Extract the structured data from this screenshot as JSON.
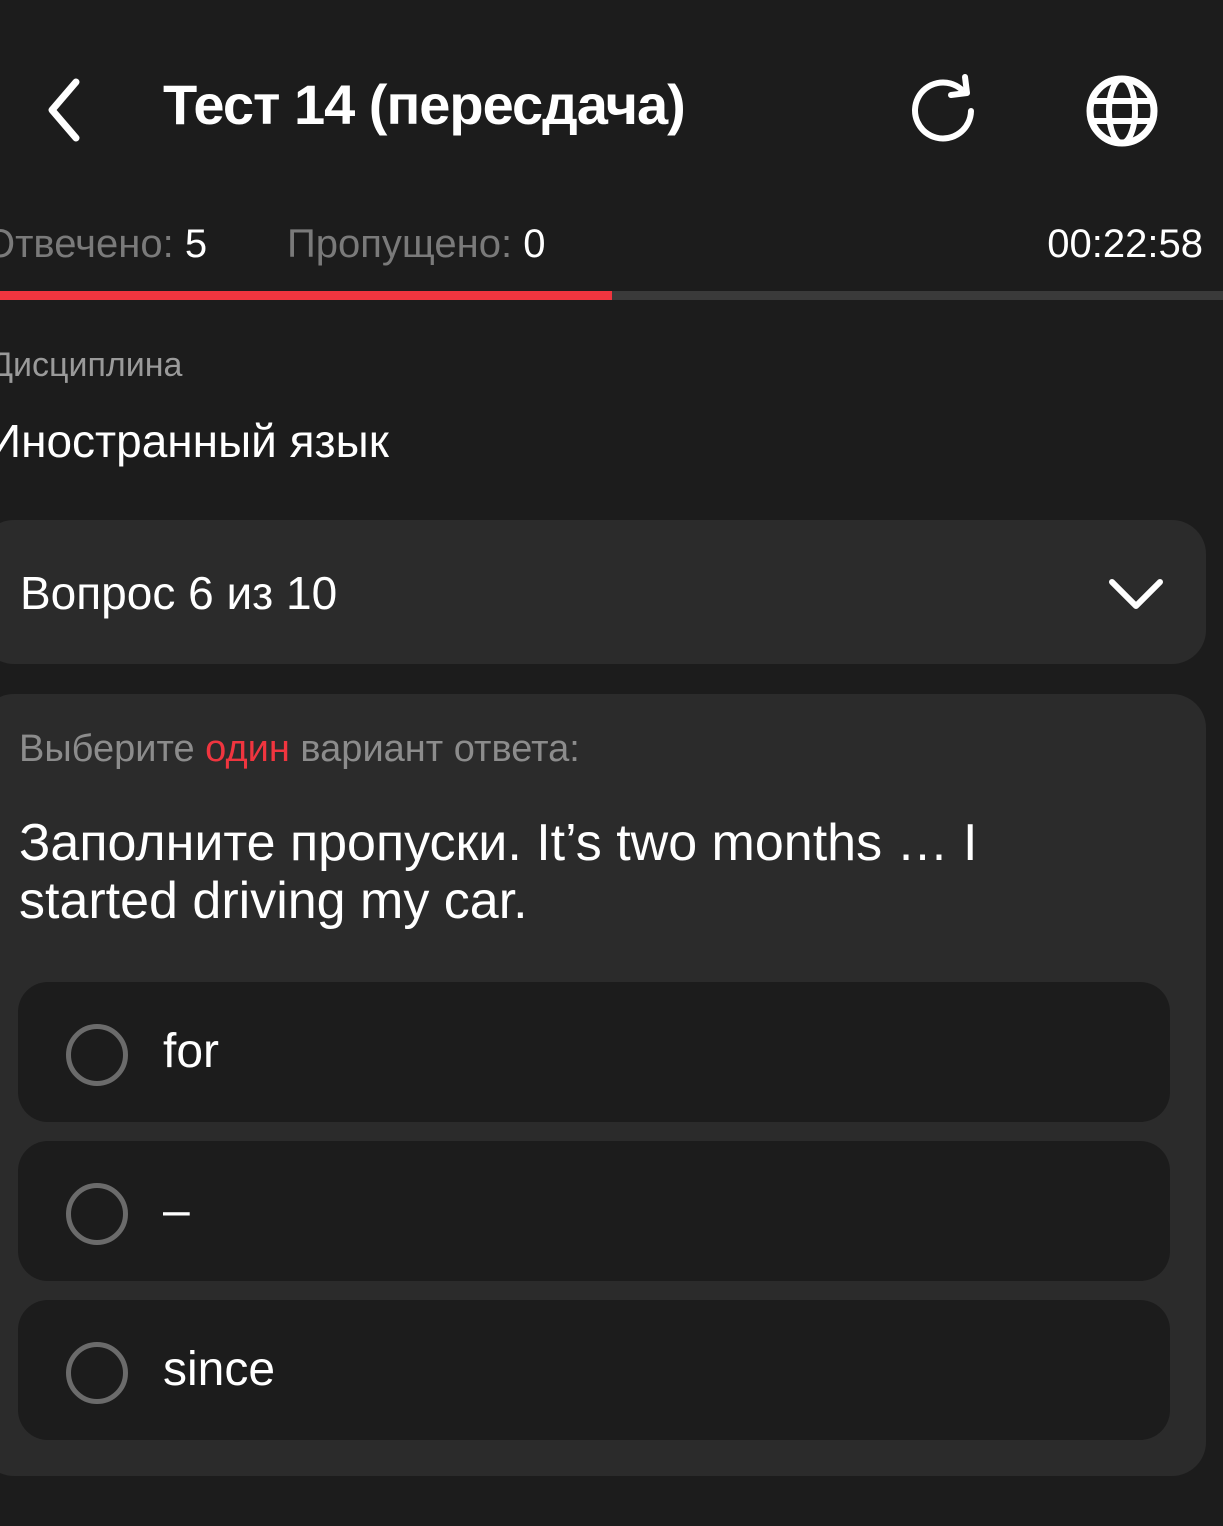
{
  "header": {
    "title": "Тест 14 (пересдача)",
    "back_icon": "chevron-left-icon",
    "refresh_icon": "refresh-icon",
    "language_icon": "globe-icon"
  },
  "stats": {
    "answered_label": "Отвечено:",
    "answered_value": "5",
    "skipped_label": "Пропущено:",
    "skipped_value": "0",
    "timer": "00:22:58"
  },
  "progress": {
    "fraction": 0.5,
    "fill_color": "#f0353f",
    "track_color": "#3a3a3a"
  },
  "discipline": {
    "label": "Дисциплина",
    "value": "Иностранный язык"
  },
  "question_selector": {
    "label": "Вопрос 6 из 10",
    "icon": "chevron-down-icon"
  },
  "question": {
    "instruction_prefix": "Выберите ",
    "instruction_accent": "один",
    "instruction_suffix": " вариант ответа:",
    "text": "Заполните пропуски. It’s two months … I started driving my car.",
    "options": [
      {
        "label": "for"
      },
      {
        "label": "–"
      },
      {
        "label": "since"
      }
    ]
  },
  "colors": {
    "background": "#1c1c1c",
    "card": "#2b2b2b",
    "accent": "#f0353f"
  }
}
